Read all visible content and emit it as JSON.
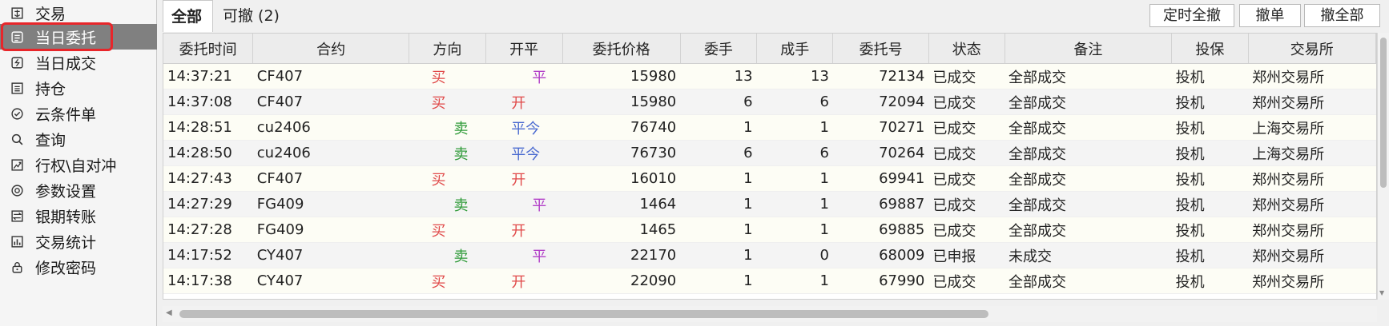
{
  "sidebar": {
    "items": [
      {
        "label": "交易",
        "icon": "trade-icon"
      },
      {
        "label": "当日委托",
        "icon": "order-icon",
        "active": true
      },
      {
        "label": "当日成交",
        "icon": "deal-icon"
      },
      {
        "label": "持仓",
        "icon": "position-icon"
      },
      {
        "label": "云条件单",
        "icon": "condition-icon"
      },
      {
        "label": "查询",
        "icon": "search-icon"
      },
      {
        "label": "行权\\自对冲",
        "icon": "exercise-icon"
      },
      {
        "label": "参数设置",
        "icon": "settings-icon"
      },
      {
        "label": "银期转账",
        "icon": "transfer-icon"
      },
      {
        "label": "交易统计",
        "icon": "stats-icon"
      },
      {
        "label": "修改密码",
        "icon": "lock-icon"
      }
    ],
    "highlight_color": "#e8262a"
  },
  "tabs": [
    {
      "label": "全部",
      "active": true
    },
    {
      "label": "可撤 (2)",
      "active": false
    }
  ],
  "toolbar": {
    "timed_cancel_all": "定时全撤",
    "cancel": "撤单",
    "cancel_all": "撤全部"
  },
  "table": {
    "columns": [
      "委托时间",
      "合约",
      "方向",
      "开平",
      "委托价格",
      "委手",
      "成手",
      "委托号",
      "状态",
      "备注",
      "投保",
      "交易所"
    ],
    "rows": [
      {
        "time": "14:37:21",
        "contract": "CF407",
        "dir": "买",
        "oc": "平",
        "price": "15980",
        "vol": "13",
        "filled": "13",
        "order_no": "72134",
        "status": "已成交",
        "note": "全部成交",
        "hedge": "投机",
        "exchange": "郑州交易所"
      },
      {
        "time": "14:37:08",
        "contract": "CF407",
        "dir": "买",
        "oc": "开",
        "price": "15980",
        "vol": "6",
        "filled": "6",
        "order_no": "72094",
        "status": "已成交",
        "note": "全部成交",
        "hedge": "投机",
        "exchange": "郑州交易所"
      },
      {
        "time": "14:28:51",
        "contract": "cu2406",
        "dir": "卖",
        "oc": "平今",
        "price": "76740",
        "vol": "1",
        "filled": "1",
        "order_no": "70271",
        "status": "已成交",
        "note": "全部成交",
        "hedge": "投机",
        "exchange": "上海交易所"
      },
      {
        "time": "14:28:50",
        "contract": "cu2406",
        "dir": "卖",
        "oc": "平今",
        "price": "76730",
        "vol": "6",
        "filled": "6",
        "order_no": "70264",
        "status": "已成交",
        "note": "全部成交",
        "hedge": "投机",
        "exchange": "上海交易所"
      },
      {
        "time": "14:27:43",
        "contract": "CF407",
        "dir": "买",
        "oc": "开",
        "price": "16010",
        "vol": "1",
        "filled": "1",
        "order_no": "69941",
        "status": "已成交",
        "note": "全部成交",
        "hedge": "投机",
        "exchange": "郑州交易所"
      },
      {
        "time": "14:27:29",
        "contract": "FG409",
        "dir": "卖",
        "oc": "平",
        "price": "1464",
        "vol": "1",
        "filled": "1",
        "order_no": "69887",
        "status": "已成交",
        "note": "全部成交",
        "hedge": "投机",
        "exchange": "郑州交易所"
      },
      {
        "time": "14:27:28",
        "contract": "FG409",
        "dir": "买",
        "oc": "开",
        "price": "1465",
        "vol": "1",
        "filled": "1",
        "order_no": "69885",
        "status": "已成交",
        "note": "全部成交",
        "hedge": "投机",
        "exchange": "郑州交易所"
      },
      {
        "time": "14:17:52",
        "contract": "CY407",
        "dir": "卖",
        "oc": "平",
        "price": "22170",
        "vol": "1",
        "filled": "0",
        "order_no": "68009",
        "status": "已申报",
        "note": "未成交",
        "hedge": "投机",
        "exchange": "郑州交易所"
      },
      {
        "time": "14:17:38",
        "contract": "CY407",
        "dir": "买",
        "oc": "开",
        "price": "22090",
        "vol": "1",
        "filled": "1",
        "order_no": "67990",
        "status": "已成交",
        "note": "全部成交",
        "hedge": "投机",
        "exchange": "郑州交易所"
      }
    ]
  },
  "colors": {
    "buy": "#e04848",
    "sell": "#2e9a38",
    "close": "#b23fc8",
    "close_today": "#4a6ad0",
    "open": "#e04848",
    "active_nav_bg": "#808080"
  }
}
